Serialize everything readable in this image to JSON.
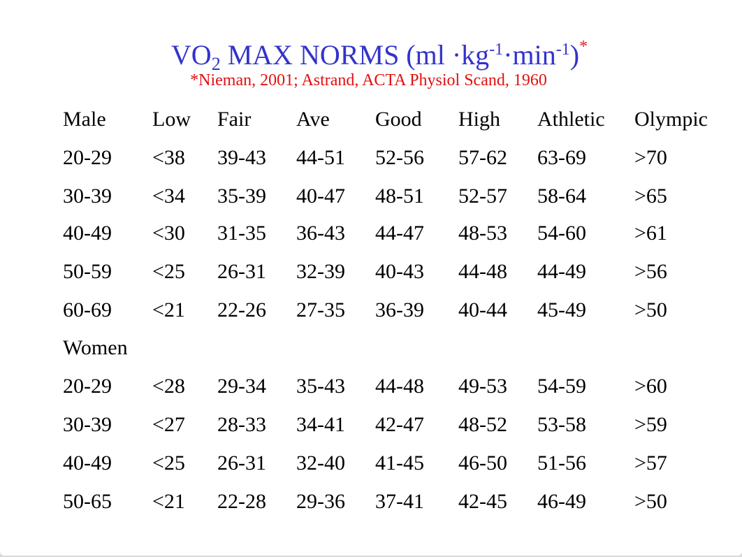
{
  "title": {
    "prefix": "VO",
    "subscript": "2",
    "main": " MAX NORMS (ml ·kg",
    "sup1": "-1",
    "mid": "·min",
    "sup2": "-1",
    "close": ")",
    "footnote_mark": "*"
  },
  "citation": "*Nieman, 2001; Astrand, ACTA Physiol Scand, 1960",
  "colors": {
    "title": "#3333cc",
    "citation": "#e01010",
    "text": "#000000"
  },
  "table": {
    "header": [
      "Male",
      "Low",
      "Fair",
      "Ave",
      "Good",
      "High",
      "Athletic",
      "Olympic"
    ],
    "male_rows": [
      [
        "20-29",
        "<38",
        "39-43",
        "44-51",
        "52-56",
        "57-62",
        "63-69",
        ">70"
      ],
      [
        "30-39",
        "<34",
        "35-39",
        "40-47",
        "48-51",
        "52-57",
        "58-64",
        ">65"
      ],
      [
        "40-49",
        "<30",
        "31-35",
        "36-43",
        "44-47",
        "48-53",
        "54-60",
        ">61"
      ],
      [
        "50-59",
        "<25",
        "26-31",
        "32-39",
        "40-43",
        "44-48",
        "44-49",
        ">56"
      ],
      [
        "60-69",
        "<21",
        "22-26",
        "27-35",
        "36-39",
        "40-44",
        "45-49",
        ">50"
      ]
    ],
    "women_label": "Women",
    "women_rows": [
      [
        "20-29",
        "<28",
        "29-34",
        "35-43",
        "44-48",
        "49-53",
        "54-59",
        ">60"
      ],
      [
        "30-39",
        "<27",
        "28-33",
        "34-41",
        "42-47",
        "48-52",
        "53-58",
        ">59"
      ],
      [
        "40-49",
        "<25",
        "26-31",
        "32-40",
        "41-45",
        "46-50",
        "51-56",
        ">57"
      ],
      [
        "50-65",
        "<21",
        "22-28",
        "29-36",
        "37-41",
        "42-45",
        "46-49",
        ">50"
      ]
    ]
  }
}
